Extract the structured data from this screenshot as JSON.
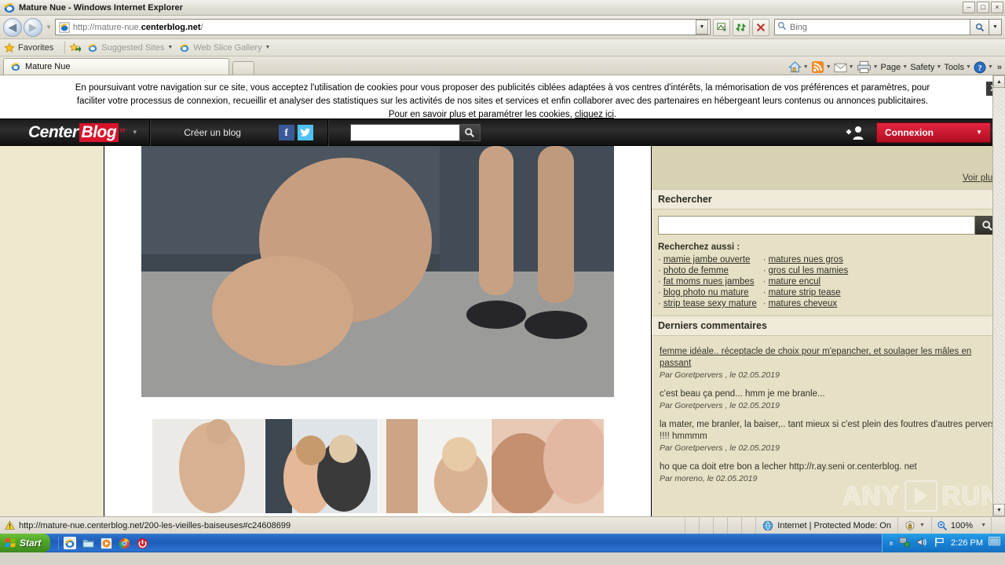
{
  "window": {
    "title": "Mature Nue - Windows Internet Explorer",
    "minimize": "–",
    "maximize": "□",
    "close": "×"
  },
  "navbar": {
    "back": "◀",
    "forward": "▶",
    "url_prefix": "http://mature-nue.",
    "url_domain": "centerblog.net",
    "url_suffix": "/",
    "address_dropdown": "▼",
    "compat_icon": "compatibility-view-icon",
    "refresh_icon": "refresh-icon",
    "stop_icon": "stop-icon",
    "search_placeholder": "Bing",
    "search_go_icon": "search-icon",
    "search_dropdown": "▼"
  },
  "favbar": {
    "favorites": "Favorites",
    "suggested_sites": "Suggested Sites",
    "web_slice_gallery": "Web Slice Gallery",
    "caret": "▼"
  },
  "tabs": {
    "items": [
      {
        "label": "Mature Nue"
      }
    ],
    "new_tab_label": ""
  },
  "command_bar": {
    "home": "home-icon",
    "feeds": "feeds-icon",
    "mail": "mail-icon",
    "print": "print-icon",
    "page": "Page",
    "safety": "Safety",
    "tools": "Tools",
    "help": "help-icon",
    "overflow": "»",
    "caret": "▼"
  },
  "cookie_banner": {
    "line1": "En poursuivant votre navigation sur ce site, vous acceptez l'utilisation de cookies pour vous proposer des publicités ciblées adaptées à vos centres d'intérêts, la mémorisation de vos préférences et paramètres, pour",
    "line2": "faciliter votre processus de connexion, recueillir et analyser des statistiques sur les activités de nos sites et services et enfin collaborer avec des partenaires en hébergeant leurs contenus ou annonces publicitaires.",
    "line3_prefix": "Pour en savoir plus et paramétrer les cookies, ",
    "line3_link": "cliquez ici",
    "line3_suffix": ".",
    "close_label": "X"
  },
  "site_header": {
    "logo_part1": "Center",
    "logo_part2": "Blog",
    "logo_quote": "”",
    "logo_dropdown": "▼",
    "create_blog": "Créer un blog",
    "facebook": "f",
    "twitter": "t",
    "search_value": "",
    "search_icon": "search-icon",
    "add_user_icon": "add-user-icon",
    "login_label": "Connexion",
    "login_caret": "▼",
    "accent_color": "#d8132b"
  },
  "sidebar": {
    "voir_plus": "Voir plus",
    "search_heading": "Rechercher",
    "search_value": "",
    "search_icon": "search-icon",
    "also_search_label": "Recherchez aussi :",
    "tags_col1": [
      "mamie jambe ouverte",
      "photo de femme",
      "fat moms nues jambes",
      "blog photo nu mature",
      "strip tease sexy mature"
    ],
    "tags_col2": [
      "matures nues gros",
      "gros cul les mamies",
      "mature encul",
      "mature strip tease",
      "matures cheveux"
    ],
    "comments_heading": "Derniers commentaires",
    "comments": [
      {
        "text": "femme idéale.. réceptacle de choix pour m'epancher, et soulager les mâles en passant",
        "meta": "Par Goretpervers , le 02.05.2019",
        "link": true
      },
      {
        "text": "c'est beau ça pend... hmm je me branle...",
        "meta": "Par Goretpervers , le 02.05.2019",
        "link": false
      },
      {
        "text": "la mater, me branler, la baiser,.. tant mieux si c'est plein des foutres d'autres pervers !!!! hmmmm",
        "meta": "Par Goretpervers , le 02.05.2019",
        "link": false
      },
      {
        "text": "ho que ca doit etre bon a lecher http://r.ay.seni or.centerblog. net",
        "meta": "Par moreno, le 02.05.2019",
        "link": false
      }
    ]
  },
  "watermark": {
    "text_left": "ANY",
    "text_right": "RUN",
    "play_icon": "play-icon"
  },
  "scrollbar": {
    "up": "▲",
    "down": "▼"
  },
  "statusbar": {
    "security_icon": "warning-icon",
    "url": "http://mature-nue.centerblog.net/200-les-vieilles-baiseuses#c24608699",
    "zone_icon": "globe-icon",
    "zone": "Internet | Protected Mode: On",
    "privacy_icon": "privacy-report-icon",
    "zoom_icon": "zoom-icon",
    "zoom_level": "100%",
    "caret": "▼"
  },
  "taskbar": {
    "start": "Start",
    "quick_launch": [
      "internet-explorer-icon",
      "folder-icon",
      "media-player-icon",
      "chrome-icon",
      "shutdown-icon"
    ],
    "tray_expand": "«",
    "tray_icons": [
      "network-icon",
      "volume-icon",
      "flag-icon"
    ],
    "clock": "2:26 PM",
    "show_desktop": "show-desktop-icon"
  }
}
